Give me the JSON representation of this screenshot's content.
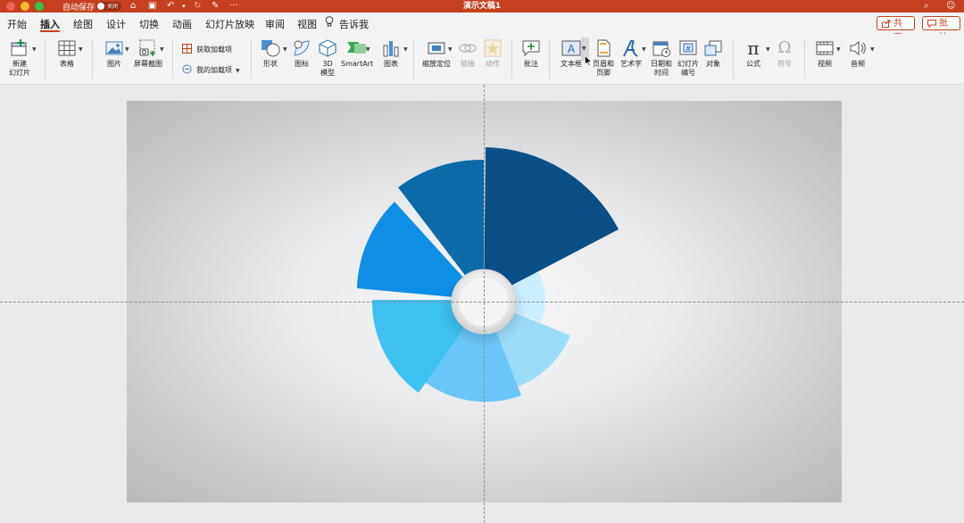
{
  "titlebar": {
    "autosave_label": "自动保存",
    "autosave_state": "关闭",
    "document_title": "演示文稿1",
    "colors": {
      "background": "#c4401e"
    }
  },
  "tabs": [
    {
      "label": "开始"
    },
    {
      "label": "插入",
      "active": true
    },
    {
      "label": "绘图"
    },
    {
      "label": "设计"
    },
    {
      "label": "切换"
    },
    {
      "label": "动画"
    },
    {
      "label": "幻灯片放映"
    },
    {
      "label": "审阅"
    },
    {
      "label": "视图"
    }
  ],
  "tellme_label": "告诉我",
  "share_label": "共享",
  "comment_label": "批注",
  "ribbon": {
    "new_slide": "新建\n幻灯片",
    "table": "表格",
    "picture": "图片",
    "screenshot": "屏幕截图",
    "get_addins": "获取加载项",
    "my_addins": "我的加载项",
    "shapes": "形状",
    "icons": "图标",
    "model3d": "3D\n模型",
    "smartart": "SmartArt",
    "chart": "图表",
    "zoom": "缩放定位",
    "link": "链接",
    "action": "动作",
    "comment": "批注",
    "textbox": "文本框",
    "header_footer": "页眉和\n页脚",
    "wordart": "艺术字",
    "datetime": "日期和\n时间",
    "slide_number": "幻灯片\n编号",
    "object": "对象",
    "equation": "公式",
    "symbol": "符号",
    "video": "视频",
    "audio": "音频"
  },
  "icons": {
    "home": "home-icon",
    "save": "save-icon",
    "undo": "undo-icon",
    "redo": "redo-icon",
    "more": "more-icon",
    "search": "search-icon",
    "account": "account-icon",
    "lightbulb": "lightbulb-icon"
  },
  "slide_graphic": {
    "colors": [
      "#0a4f86",
      "#0d6aa8",
      "#0d8fe6",
      "#3ec1f0",
      "#6ac6f8",
      "#9bdcfb",
      "#cbeeff"
    ],
    "center_knob": "#f4f4f4"
  }
}
